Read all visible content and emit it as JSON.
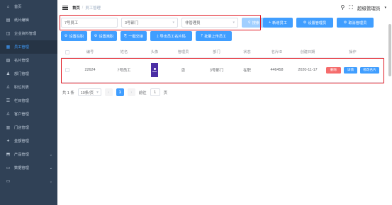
{
  "sidebar": {
    "items": [
      {
        "label": "首页",
        "icon": "home-icon",
        "glyph": "⌂",
        "has_arrow": false
      },
      {
        "label": "纸片编辑",
        "icon": "document-icon",
        "glyph": "▤",
        "has_arrow": false
      },
      {
        "label": "企业资料管理",
        "icon": "building-icon",
        "glyph": "◫",
        "has_arrow": false
      },
      {
        "label": "员工管理",
        "icon": "user-group-icon",
        "glyph": "▦",
        "has_arrow": false,
        "active": true
      },
      {
        "label": "名片管理",
        "icon": "card-icon",
        "glyph": "▧",
        "has_arrow": false
      },
      {
        "label": "部门管理",
        "icon": "org-icon",
        "glyph": "♟",
        "has_arrow": false
      },
      {
        "label": "职位列表",
        "icon": "badge-icon",
        "glyph": "♙",
        "has_arrow": false
      },
      {
        "label": "栏目管理",
        "icon": "list-icon",
        "glyph": "☰",
        "has_arrow": false
      },
      {
        "label": "客户管理",
        "icon": "person-icon",
        "glyph": "♙",
        "has_arrow": false
      },
      {
        "label": "门店管理",
        "icon": "store-icon",
        "glyph": "▥",
        "has_arrow": false
      },
      {
        "label": "金额管理",
        "icon": "star-icon",
        "glyph": "✦",
        "has_arrow": false
      },
      {
        "label": "产品管理",
        "icon": "box-icon",
        "glyph": "⬒",
        "has_arrow": true
      },
      {
        "label": "数据管理",
        "icon": "chart-icon",
        "glyph": "▭",
        "has_arrow": true
      },
      {
        "label": "",
        "icon": "more-icon",
        "glyph": "▭",
        "has_arrow": true
      }
    ]
  },
  "header": {
    "breadcrumb_home": "首页",
    "breadcrumb_sep": "/",
    "breadcrumb_current": "员工管理",
    "user_name": "超级管理员"
  },
  "filters": {
    "name_value": "7号员工",
    "dept_value": "3号部门",
    "role_value": "非管理员",
    "search_label": "搜索"
  },
  "toolbar": {
    "row1": [
      {
        "label": "新增员工",
        "glyph": "+",
        "name": "add-employee-button"
      },
      {
        "label": "设置管理员",
        "glyph": "⚙",
        "name": "set-admin-button"
      },
      {
        "label": "取消管理员",
        "glyph": "⚙",
        "name": "cancel-admin-button"
      }
    ],
    "row2": [
      {
        "label": "设置在职",
        "glyph": "⚙",
        "name": "set-active-button"
      },
      {
        "label": "设置离职",
        "glyph": "⚙",
        "name": "set-resigned-button"
      },
      {
        "label": "一键交接",
        "glyph": "⎘",
        "name": "handover-button"
      },
      {
        "label": "导出员工名片码",
        "glyph": "⤓",
        "name": "export-card-code-button"
      },
      {
        "label": "批量上传员工",
        "glyph": "⤒",
        "name": "batch-upload-button"
      }
    ]
  },
  "table": {
    "columns": [
      "编号",
      "姓名",
      "头像",
      "管理员",
      "部门",
      "状态",
      "名片ID",
      "创建日期",
      "操作"
    ],
    "rows": [
      {
        "id": "22624",
        "name": "7号员工",
        "admin": "否",
        "dept": "3号部门",
        "status": "在职",
        "card_id": "446458",
        "date": "2020-11-17"
      }
    ],
    "actions": {
      "delete": "删除",
      "detail": "详情",
      "card": "修改名片"
    }
  },
  "pagination": {
    "total": "共 1 条",
    "page_size": "10条/页",
    "current": "1",
    "goto_label": "前往",
    "goto_value": "1",
    "page_suffix": "页"
  },
  "colors": {
    "primary": "#409eff",
    "danger": "#f56c6c",
    "sidebar_bg": "#304156",
    "highlight_box": "#e0151f"
  }
}
